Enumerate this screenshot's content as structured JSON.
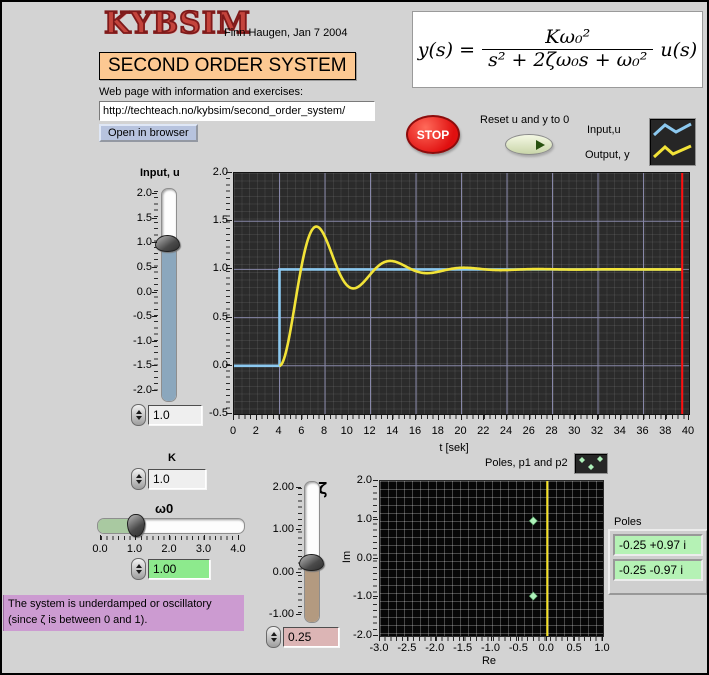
{
  "header": {
    "logo": "KYBSIM",
    "byline": "Finn Haugen, Jan 7 2004",
    "title": "SECOND ORDER SYSTEM",
    "webpage_label": "Web page with information and exercises:",
    "url": "http://techteach.no/kybsim/second_order_system/",
    "open_button": "Open in browser"
  },
  "formula": {
    "lhs": "y(s) =",
    "numerator": "Kω₀²",
    "denominator": "s² + 2ζω₀s + ω₀²",
    "rhs": "u(s)"
  },
  "stop_button": "STOP",
  "reset": {
    "label": "Reset u and y to 0"
  },
  "legend": {
    "input_label": "Input,u",
    "output_label": "Output, y",
    "input_color": "#8cc9f0",
    "output_color": "#f2e338"
  },
  "input_slider": {
    "label": "Input, u",
    "value": "1.0",
    "val": 1.0,
    "min": -2.0,
    "max": 2.0,
    "ticks": [
      "2.0",
      "1.5",
      "1.0",
      "0.5",
      "0.0",
      "-0.5",
      "-1.0",
      "-1.5",
      "-2.0"
    ],
    "fill_color": "#8ba7bd"
  },
  "k_control": {
    "label": "K",
    "value": "1.0"
  },
  "omega_control": {
    "label": "ω0",
    "value": "1.00",
    "val": 1.0,
    "min": 0.0,
    "max": 4.0,
    "ticks": [
      "0.0",
      "1.0",
      "2.0",
      "3.0",
      "4.0"
    ],
    "fill_color": "#a9c9a1"
  },
  "zeta_control": {
    "label": "ζ",
    "value": "0.25",
    "val": 0.25,
    "min": -1.0,
    "max": 2.0,
    "ticks": [
      "2.00",
      "1.00",
      "0.00",
      "-1.00"
    ],
    "fill_color": "#b39a80"
  },
  "poles_display": {
    "label": "Poles",
    "values": [
      "-0.25 +0.97 i",
      "-0.25 -0.97 i"
    ]
  },
  "message": "The system is underdamped or oscillatory (since ζ is between 0 and 1).",
  "chart_data": [
    {
      "type": "line",
      "xlabel": "t [sek]",
      "xlim": [
        0,
        40
      ],
      "ylim": [
        -0.5,
        2.0
      ],
      "xticks": [
        "0",
        "2",
        "4",
        "6",
        "8",
        "10",
        "12",
        "14",
        "16",
        "18",
        "20",
        "22",
        "24",
        "26",
        "28",
        "30",
        "32",
        "34",
        "36",
        "38",
        "40"
      ],
      "yticks": [
        "2.0",
        "1.5",
        "1.0",
        "0.5",
        "0.0",
        "-0.5"
      ],
      "x_major_grid": [
        4,
        8,
        12,
        16,
        20,
        24,
        28,
        32,
        36
      ],
      "y_major_grid": [
        1.5,
        1.0,
        0.5,
        0.0
      ],
      "grid_color": "#8787a8",
      "series": [
        {
          "name": "Input,u",
          "color": "#8cc9f0",
          "points": [
            [
              0,
              0
            ],
            [
              4,
              0
            ],
            [
              4,
              1
            ],
            [
              39.4,
              1
            ]
          ]
        },
        {
          "name": "Output, y",
          "color": "#f2e338",
          "model": {
            "K": 1.0,
            "omega0": 1.0,
            "zeta": 0.25,
            "step_time": 4.0,
            "t_end": 39.4
          }
        }
      ],
      "cursor": {
        "x": 39.4,
        "color": "#ff1010"
      }
    },
    {
      "type": "scatter",
      "title": "Poles, p1 and p2",
      "xlabel": "Re",
      "ylabel": "Im",
      "xlim": [
        -3.0,
        1.0
      ],
      "ylim": [
        -2.0,
        2.0
      ],
      "xticks": [
        "-3.0",
        "-2.5",
        "-2.0",
        "-1.5",
        "-1.0",
        "-0.5",
        "0.0",
        "0.5",
        "1.0"
      ],
      "yticks": [
        "2.0",
        "1.0",
        "0.0",
        "-1.0",
        "-2.0"
      ],
      "points": [
        [
          -0.25,
          0.97
        ],
        [
          -0.25,
          -0.97
        ]
      ],
      "point_color": "#aef0ba",
      "vline": {
        "x": 0,
        "color": "#f7e32a"
      }
    }
  ]
}
